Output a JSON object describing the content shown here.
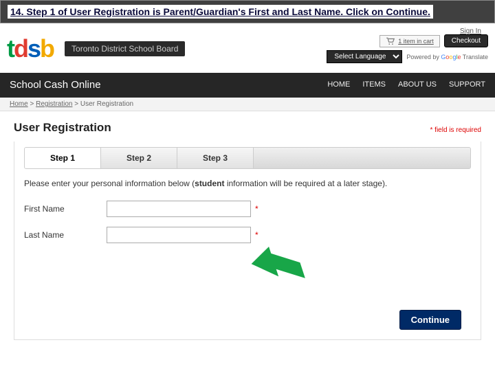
{
  "instruction": "14. Step 1 of User Registration is Parent/Guardian's First and Last Name. Click on Continue.",
  "signin": "Sign In",
  "logo": {
    "t": "t",
    "d": "d",
    "s": "s",
    "b": "b"
  },
  "board_name": "Toronto District School Board",
  "cart": {
    "text": "1 item in cart",
    "checkout": "Checkout"
  },
  "language": {
    "selected": "Select Language",
    "powered": "Powered by ",
    "brand": "Google",
    "translate": " Translate"
  },
  "nav": {
    "title": "School Cash Online",
    "links": [
      "HOME",
      "ITEMS",
      "ABOUT US",
      "SUPPORT"
    ]
  },
  "breadcrumb": {
    "home": "Home",
    "reg": "Registration",
    "user": "User Registration",
    "sep": " > "
  },
  "page_title": "User Registration",
  "required_note": "* field is required",
  "steps": [
    "Step 1",
    "Step 2",
    "Step 3"
  ],
  "form": {
    "note_pre": "Please enter your personal information below (",
    "note_bold": "student",
    "note_post": " information will be required at a later stage).",
    "first": "First Name",
    "last": "Last Name",
    "asterisk": "*"
  },
  "continue": "Continue"
}
